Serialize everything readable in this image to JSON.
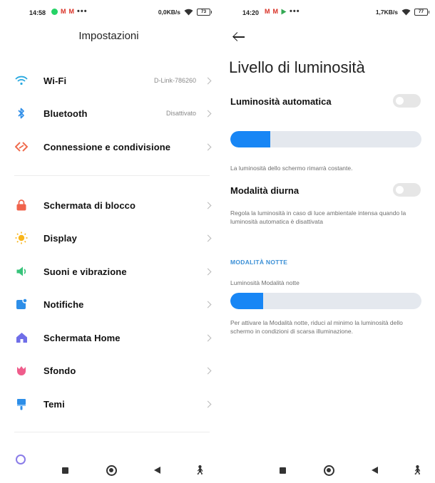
{
  "left": {
    "status": {
      "time": "14:58",
      "gmail1": "M",
      "gmail2": "M",
      "more": "•••",
      "speed": "0,0KB/s",
      "battery": "73"
    },
    "title": "Impostazioni",
    "items": [
      {
        "label": "Wi-Fi",
        "value": "D-Link-786260",
        "icon": "wifi-icon",
        "color": "#29a9e0"
      },
      {
        "label": "Bluetooth",
        "value": "Disattivato",
        "icon": "bluetooth-icon",
        "color": "#2f8ee8"
      },
      {
        "label": "Connessione e condivisione",
        "value": "",
        "icon": "share-icon",
        "color": "#ef6b4d"
      },
      {
        "label": "Schermata di blocco",
        "value": "",
        "icon": "lock-icon",
        "color": "#f0634c"
      },
      {
        "label": "Display",
        "value": "",
        "icon": "sun-icon",
        "color": "#f8b51b"
      },
      {
        "label": "Suoni e vibrazione",
        "value": "",
        "icon": "speaker-icon",
        "color": "#37c37a"
      },
      {
        "label": "Notifiche",
        "value": "",
        "icon": "notification-icon",
        "color": "#2d8ee8"
      },
      {
        "label": "Schermata Home",
        "value": "",
        "icon": "home-icon",
        "color": "#6f6ee8"
      },
      {
        "label": "Sfondo",
        "value": "",
        "icon": "tulip-icon",
        "color": "#ef5c8b"
      },
      {
        "label": "Temi",
        "value": "",
        "icon": "brush-icon",
        "color": "#2d8ee8"
      }
    ]
  },
  "right": {
    "status": {
      "time": "14:20",
      "gmail1": "M",
      "gmail2": "M",
      "more": "•••",
      "speed": "1,7KB/s",
      "battery": "77"
    },
    "title": "Livello di luminosità",
    "auto_label": "Luminosità automatica",
    "auto_on": false,
    "brightness_level": 0.21,
    "auto_desc": "La luminosità dello schermo rimarrà costante.",
    "day_label": "Modalità diurna",
    "day_on": false,
    "day_desc": "Regola la luminosità in caso di luce ambientale intensa quando la luminosità automatica è disattivata",
    "night_section": "MODALITÀ NOTTE",
    "night_label": "Luminosità Modalità notte",
    "night_level": 0.17,
    "night_desc": "Per attivare la Modalità notte, riduci al minimo la luminosità dello schermo in condizioni di scarsa illuminazione."
  },
  "colors": {
    "accent": "#1886f5",
    "track": "#e4e8ee",
    "section": "#3a8fd6"
  }
}
